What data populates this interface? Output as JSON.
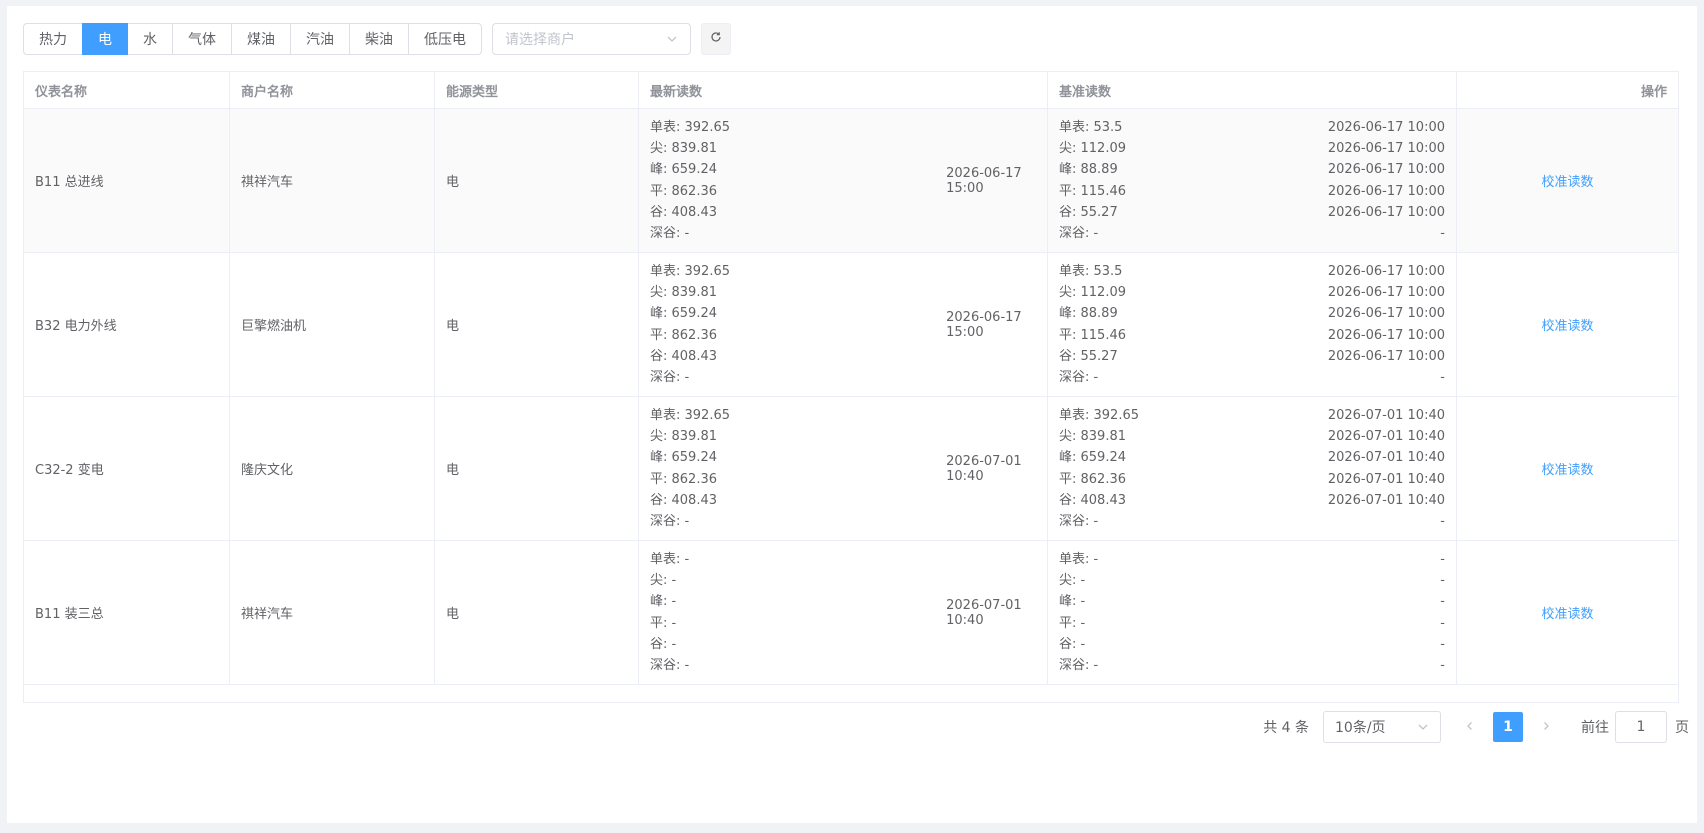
{
  "energy_tabs": [
    {
      "label": "热力",
      "active": false
    },
    {
      "label": "电",
      "active": true
    },
    {
      "label": "水",
      "active": false
    },
    {
      "label": "气体",
      "active": false
    },
    {
      "label": "煤油",
      "active": false
    },
    {
      "label": "汽油",
      "active": false
    },
    {
      "label": "柴油",
      "active": false
    },
    {
      "label": "低压电",
      "active": false
    }
  ],
  "merchant_select": {
    "placeholder": "请选择商户",
    "icon": "chevron-down-icon"
  },
  "refresh": {
    "icon": "refresh-icon"
  },
  "table": {
    "headers": [
      "仪表名称",
      "商户名称",
      "能源类型",
      "最新读数",
      "基准读数",
      "操作"
    ],
    "rows": [
      {
        "meter": "B11 总进线",
        "merchant": "祺祥汽车",
        "energy": "电",
        "latest_lines": [
          "单表: 392.65",
          "尖: 839.81",
          "峰: 659.24",
          "平: 862.36",
          "谷: 408.43",
          "深谷: -"
        ],
        "latest_time": "2026-06-17 15:00",
        "base_lines": [
          {
            "v": "单表: 53.5",
            "t": "2026-06-17 10:00"
          },
          {
            "v": "尖: 112.09",
            "t": "2026-06-17 10:00"
          },
          {
            "v": "峰: 88.89",
            "t": "2026-06-17 10:00"
          },
          {
            "v": "平: 115.46",
            "t": "2026-06-17 10:00"
          },
          {
            "v": "谷: 55.27",
            "t": "2026-06-17 10:00"
          },
          {
            "v": "深谷: -",
            "t": "-"
          }
        ],
        "action": "校准读数"
      },
      {
        "meter": "B32 电力外线",
        "merchant": "巨擎燃油机",
        "energy": "电",
        "latest_lines": [
          "单表: 392.65",
          "尖: 839.81",
          "峰: 659.24",
          "平: 862.36",
          "谷: 408.43",
          "深谷: -"
        ],
        "latest_time": "2026-06-17 15:00",
        "base_lines": [
          {
            "v": "单表: 53.5",
            "t": "2026-06-17 10:00"
          },
          {
            "v": "尖: 112.09",
            "t": "2026-06-17 10:00"
          },
          {
            "v": "峰: 88.89",
            "t": "2026-06-17 10:00"
          },
          {
            "v": "平: 115.46",
            "t": "2026-06-17 10:00"
          },
          {
            "v": "谷: 55.27",
            "t": "2026-06-17 10:00"
          },
          {
            "v": "深谷: -",
            "t": "-"
          }
        ],
        "action": "校准读数"
      },
      {
        "meter": "C32-2 变电",
        "merchant": "隆庆文化",
        "energy": "电",
        "latest_lines": [
          "单表: 392.65",
          "尖: 839.81",
          "峰: 659.24",
          "平: 862.36",
          "谷: 408.43",
          "深谷: -"
        ],
        "latest_time": "2026-07-01 10:40",
        "base_lines": [
          {
            "v": "单表: 392.65",
            "t": "2026-07-01 10:40"
          },
          {
            "v": "尖: 839.81",
            "t": "2026-07-01 10:40"
          },
          {
            "v": "峰: 659.24",
            "t": "2026-07-01 10:40"
          },
          {
            "v": "平: 862.36",
            "t": "2026-07-01 10:40"
          },
          {
            "v": "谷: 408.43",
            "t": "2026-07-01 10:40"
          },
          {
            "v": "深谷: -",
            "t": "-"
          }
        ],
        "action": "校准读数"
      },
      {
        "meter": "B11 装三总",
        "merchant": "祺祥汽车",
        "energy": "电",
        "latest_lines": [
          "单表: -",
          "尖: -",
          "峰: -",
          "平: -",
          "谷: -",
          "深谷: -"
        ],
        "latest_time": "2026-07-01 10:40",
        "base_lines": [
          {
            "v": "单表: -",
            "t": "-"
          },
          {
            "v": "尖: -",
            "t": "-"
          },
          {
            "v": "峰: -",
            "t": "-"
          },
          {
            "v": "平: -",
            "t": "-"
          },
          {
            "v": "谷: -",
            "t": "-"
          },
          {
            "v": "深谷: -",
            "t": "-"
          }
        ],
        "action": "校准读数"
      }
    ]
  },
  "pagination": {
    "total": "共 4 条",
    "page_size": "10条/页",
    "current_page": "1",
    "goto_label": "前往",
    "goto_value": "1",
    "page_suffix": "页"
  },
  "colors": {
    "primary": "#409eff",
    "border": "#ebeef5"
  }
}
